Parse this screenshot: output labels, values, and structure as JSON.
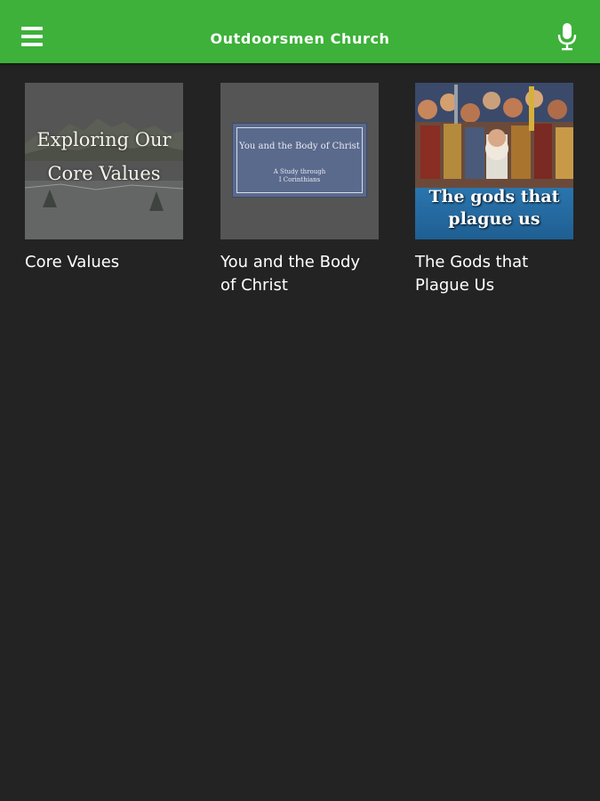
{
  "header": {
    "title": "Outdoorsmen Church",
    "menu_icon": "hamburger-menu-icon",
    "mic_icon": "microphone-icon",
    "background_color": "#3db13a"
  },
  "series": [
    {
      "label": "Core Values",
      "cover_lines": [
        "Exploring Our",
        "Core Values"
      ]
    },
    {
      "label_line1": "You and the Body",
      "label_line2": "of Christ",
      "cover_title": "You and the Body of Christ",
      "cover_subtitle_line1": "A Study through",
      "cover_subtitle_line2": "I Corinthians"
    },
    {
      "label_line1": "The Gods that",
      "label_line2": "Plague Us",
      "cover_line1": "The gods that",
      "cover_line2": "plague us"
    }
  ],
  "colors": {
    "background": "#232323",
    "text": "#ffffff"
  }
}
